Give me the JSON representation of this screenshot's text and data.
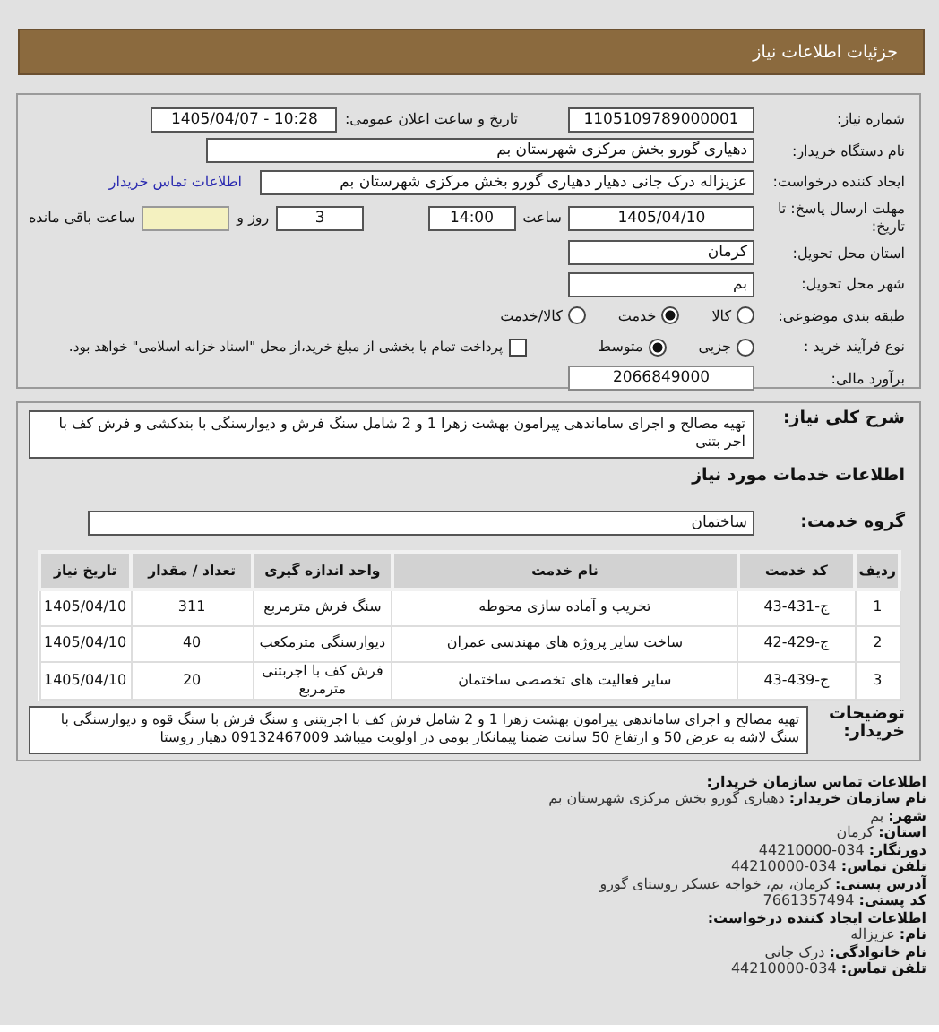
{
  "header": {
    "title": "جزئیات اطلاعات نیاز"
  },
  "need_number": {
    "label": "شماره نیاز:",
    "value": "1105109789000001"
  },
  "announce": {
    "label": "تاریخ و ساعت اعلان عمومی:",
    "value": "1405/04/07 - 10:28"
  },
  "buyer": {
    "label": "نام دستگاه خریدار:",
    "value": "دهیاری گورو بخش مرکزی شهرستان بم"
  },
  "requester": {
    "label": "ایجاد کننده درخواست:",
    "value": "عزیزاله درک جانی دهیار دهیاری گورو بخش مرکزی شهرستان بم",
    "link": "اطلاعات تماس خریدار"
  },
  "deadline": {
    "label": "مهلت ارسال پاسخ: تا تاریخ:",
    "date": "1405/04/10",
    "time_label": "ساعت",
    "time": "14:00",
    "days": "3",
    "days_label": "روز و",
    "remaining_label": "ساعت باقی مانده"
  },
  "province": {
    "label": "استان محل تحویل:",
    "value": "کرمان"
  },
  "city": {
    "label": "شهر محل تحویل:",
    "value": "بم"
  },
  "category": {
    "label": "طبقه بندی موضوعی:",
    "options": [
      {
        "label": "کالا",
        "selected": false
      },
      {
        "label": "خدمت",
        "selected": true
      },
      {
        "label": "کالا/خدمت",
        "selected": false
      }
    ]
  },
  "purchase_type": {
    "label": "نوع فرآیند خرید :",
    "options": [
      {
        "label": "جزیی",
        "selected": false
      },
      {
        "label": "متوسط",
        "selected": true
      }
    ],
    "treasury": {
      "label": "پرداخت تمام یا بخشی از مبلغ خرید،از محل \"اسناد خزانه اسلامی\" خواهد بود.",
      "checked": false
    }
  },
  "budget": {
    "label": "برآورد مالی:",
    "value": "2066849000"
  },
  "description": {
    "label": "شرح کلی نیاز:",
    "value": "تهیه مصالح و اجرای ساماندهی پیرامون بهشت زهرا 1 و 2 شامل سنگ فرش و دیوارسنگی با بندکشی و فرش کف با اجر بتنی"
  },
  "services_title": "اطلاعات خدمات مورد نیاز",
  "service_group": {
    "label": "گروه خدمت:",
    "value": "ساختمان"
  },
  "table": {
    "columns": [
      "ردیف",
      "کد خدمت",
      "نام خدمت",
      "واحد اندازه گیری",
      "تعداد / مقدار",
      "تاریخ نیاز"
    ],
    "rows": [
      [
        "1",
        "ج-431-43",
        "تخریب و آماده سازی محوطه",
        "سنگ فرش مترمربع",
        "311",
        "1405/04/10"
      ],
      [
        "2",
        "ج-429-42",
        "ساخت سایر پروژه های مهندسی عمران",
        "دیوارسنگی مترمکعب",
        "40",
        "1405/04/10"
      ],
      [
        "3",
        "ج-439-43",
        "سایر فعالیت های تخصصی ساختمان",
        "فرش کف با اجربتنی مترمربع",
        "20",
        "1405/04/10"
      ]
    ]
  },
  "buyer_notes": {
    "label": "توضیحات خریدار:",
    "value": "تهیه مصالح و اجرای ساماندهی پیرامون بهشت زهرا 1 و 2 شامل فرش کف با اجربتنی و سنگ فرش با سنگ قوه و دیوارسنگی با سنگ لاشه به عرض 50 و ارتفاع 50 سانت ضمنا پیمانکار بومی در اولویت میباشد 09132467009 دهیار روستا"
  },
  "contact": [
    {
      "kind": "heading",
      "label": "اطلاعات تماس سازمان خریدار:"
    },
    {
      "kind": "line",
      "label": "نام سازمان خریدار:",
      "value": "دهیاری گورو بخش مرکزی شهرستان بم"
    },
    {
      "kind": "line",
      "label": "شهر:",
      "value": "بم"
    },
    {
      "kind": "line",
      "label": "استان:",
      "value": "کرمان"
    },
    {
      "kind": "line",
      "label": "دورنگار:",
      "value": "034-44210000"
    },
    {
      "kind": "line",
      "label": "تلفن تماس:",
      "value": "034-44210000"
    },
    {
      "kind": "line",
      "label": "آدرس پستی:",
      "value": "کرمان، بم، خواجه عسکر روستای گورو"
    },
    {
      "kind": "line",
      "label": "کد پستی:",
      "value": "7661357494"
    },
    {
      "kind": "heading",
      "label": "اطلاعات ایجاد کننده درخواست:"
    },
    {
      "kind": "line",
      "label": "نام:",
      "value": "عزیزاله"
    },
    {
      "kind": "line",
      "label": "نام خانوادگی:",
      "value": "درک جانی"
    },
    {
      "kind": "line",
      "label": "تلفن تماس:",
      "value": "034-44210000"
    }
  ]
}
